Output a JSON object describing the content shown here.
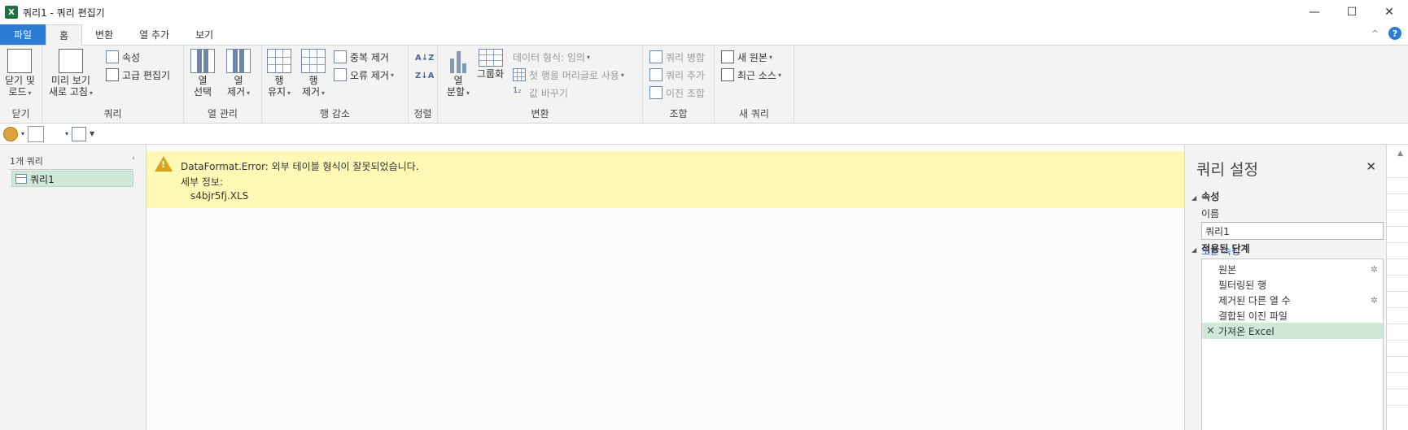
{
  "window": {
    "app_icon": "X",
    "title": "쿼리1 - 쿼리 편집기",
    "minimize": "—",
    "maximize": "☐",
    "close": "✕"
  },
  "ribbon_tabs": [
    {
      "label": "파일"
    },
    {
      "label": "홈"
    },
    {
      "label": "변환"
    },
    {
      "label": "열 추가"
    },
    {
      "label": "보기"
    }
  ],
  "tabs_right": {
    "collapse": "^",
    "help": "?"
  },
  "ribbon": {
    "close_group": {
      "btn_line1": "닫기 및",
      "btn_line2": "로드",
      "label": "닫기"
    },
    "query_group": {
      "refresh_line1": "미리 보기",
      "refresh_line2": "새로 고침",
      "properties": "속성",
      "advanced_editor": "고급 편집기",
      "label": "쿼리"
    },
    "columns_group": {
      "choose_line1": "열",
      "choose_line2": "선택",
      "remove_line1": "열",
      "remove_line2": "제거",
      "label": "열 관리"
    },
    "rows_group": {
      "keep_line1": "행",
      "keep_line2": "유지",
      "remove_line1": "행",
      "remove_line2": "제거",
      "remove_duplicates": "중복 제거",
      "remove_errors": "오류 제거",
      "label": "행 감소"
    },
    "sort_group": {
      "asc": "A↓Z",
      "desc": "Z↓A",
      "label": "정렬"
    },
    "transform_group": {
      "split_line1": "열",
      "split_line2": "분할",
      "group_by": "그룹화",
      "data_type": "데이터 형식: 임의",
      "first_row_header": "첫 행을 머리글로 사용",
      "replace_values": "값 바꾸기",
      "label": "변환"
    },
    "combine_group": {
      "merge_queries": "쿼리 병합",
      "append_queries": "쿼리 추가",
      "combine_binaries": "이진 조합",
      "label": "조합"
    },
    "newquery_group": {
      "new_source": "새 원본",
      "recent_sources": "최근 소스",
      "label": "새 쿼리"
    }
  },
  "nav": {
    "header": "1개 쿼리",
    "collapse": "‹",
    "items": [
      {
        "label": "쿼리1"
      }
    ]
  },
  "error": {
    "icon_mark": "!",
    "title": "DataFormat.Error: 외부 테이블 형식이 잘못되었습니다.",
    "detail_label": "세부 정보:",
    "detail_value": "s4bjr5fj.XLS"
  },
  "settings": {
    "title": "쿼리 설정",
    "close": "✕",
    "properties_header": "속성",
    "name_label": "이름",
    "name_value": "쿼리1",
    "all_properties": "모든 속성",
    "steps_header": "적용된 단계",
    "steps": [
      {
        "label": "원본",
        "gear": "✲"
      },
      {
        "label": "필터링된 행",
        "gear": ""
      },
      {
        "label": "제거된 다른 열 수",
        "gear": "✲"
      },
      {
        "label": "결합된 이진 파일",
        "gear": ""
      },
      {
        "label": "가져온 Excel",
        "gear": "",
        "selected": true,
        "delete": "✕"
      }
    ]
  }
}
